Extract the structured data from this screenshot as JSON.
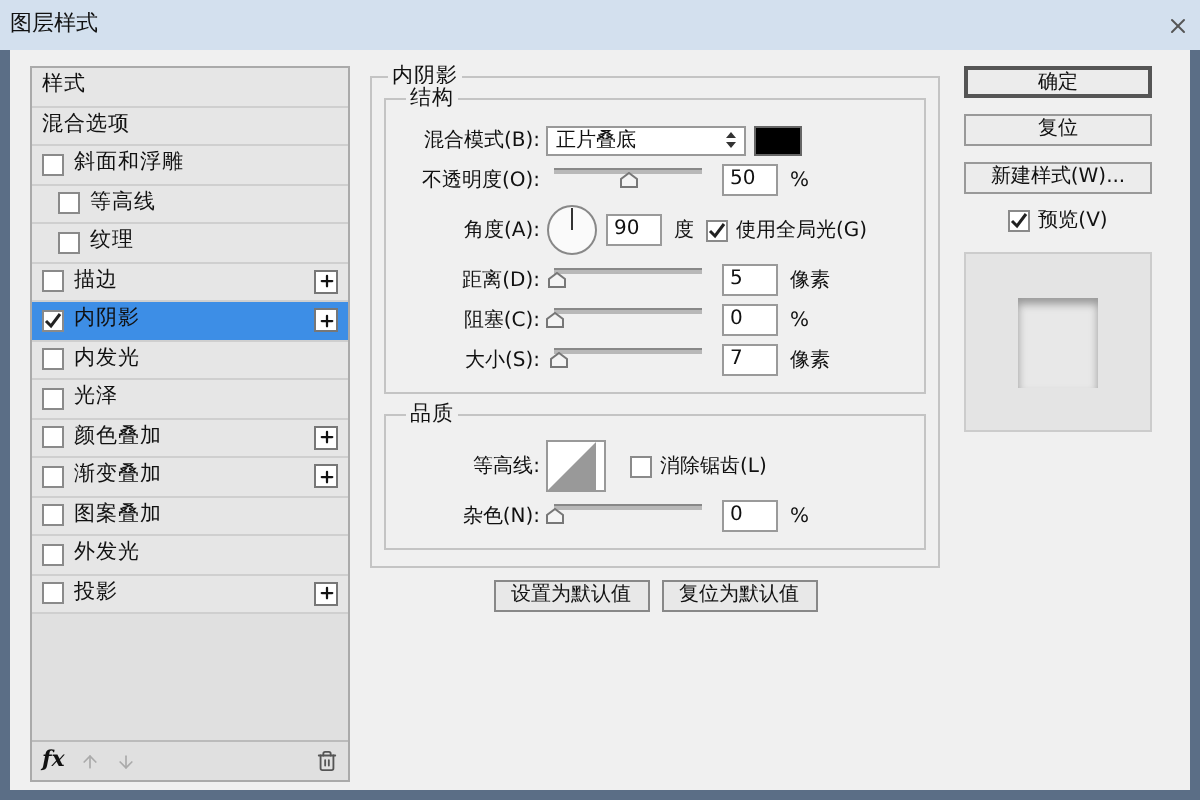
{
  "window": {
    "title": "图层样式"
  },
  "sidebar": {
    "items": [
      {
        "label": "样式",
        "kind": "header",
        "selected": false
      },
      {
        "label": "混合选项",
        "kind": "header",
        "selected": false
      },
      {
        "label": "斜面和浮雕",
        "kind": "effect",
        "checked": false,
        "addable": false,
        "selected": false,
        "children": [
          {
            "label": "等高线",
            "kind": "effect",
            "checked": false,
            "addable": false,
            "selected": false
          },
          {
            "label": "纹理",
            "kind": "effect",
            "checked": false,
            "addable": false,
            "selected": false
          }
        ]
      },
      {
        "label": "描边",
        "kind": "effect",
        "checked": false,
        "addable": true,
        "selected": false
      },
      {
        "label": "内阴影",
        "kind": "effect",
        "checked": true,
        "addable": true,
        "selected": true
      },
      {
        "label": "内发光",
        "kind": "effect",
        "checked": false,
        "addable": false,
        "selected": false
      },
      {
        "label": "光泽",
        "kind": "effect",
        "checked": false,
        "addable": false,
        "selected": false
      },
      {
        "label": "颜色叠加",
        "kind": "effect",
        "checked": false,
        "addable": true,
        "selected": false
      },
      {
        "label": "渐变叠加",
        "kind": "effect",
        "checked": false,
        "addable": true,
        "selected": false
      },
      {
        "label": "图案叠加",
        "kind": "effect",
        "checked": false,
        "addable": false,
        "selected": false
      },
      {
        "label": "外发光",
        "kind": "effect",
        "checked": false,
        "addable": false,
        "selected": false
      },
      {
        "label": "投影",
        "kind": "effect",
        "checked": false,
        "addable": true,
        "selected": false
      }
    ],
    "fx_label": "fx"
  },
  "panel": {
    "title": "内阴影",
    "structure": {
      "title": "结构",
      "blend_mode": {
        "label": "混合模式(B):",
        "value": "正片叠底"
      },
      "opacity": {
        "label": "不透明度(O):",
        "value": "50",
        "unit": "%",
        "level": 0.5
      },
      "angle": {
        "label": "角度(A):",
        "value": "90",
        "unit": "度",
        "global_light": {
          "label": "使用全局光(G)",
          "checked": true
        }
      },
      "sliders": [
        {
          "label": "距离(D):",
          "value": "5",
          "unit": "像素",
          "level": 0.02
        },
        {
          "label": "阻塞(C):",
          "value": "0",
          "unit": "%",
          "level": 0
        },
        {
          "label": "大小(S):",
          "value": "7",
          "unit": "像素",
          "level": 0.03
        }
      ]
    },
    "quality": {
      "title": "品质",
      "contour_label": "等高线:",
      "anti_alias": {
        "label": "消除锯齿(L)",
        "checked": false
      },
      "noise": {
        "label": "杂色(N):",
        "value": "0",
        "unit": "%",
        "level": 0
      }
    },
    "buttons": [
      "设置为默认值",
      "复位为默认值"
    ]
  },
  "actions": {
    "buttons": [
      {
        "label": "确定",
        "default": true
      },
      {
        "label": "复位",
        "default": false
      },
      {
        "label": "新建样式(W)...",
        "default": false
      }
    ],
    "preview": {
      "label": "预览(V)",
      "checked": true
    }
  }
}
